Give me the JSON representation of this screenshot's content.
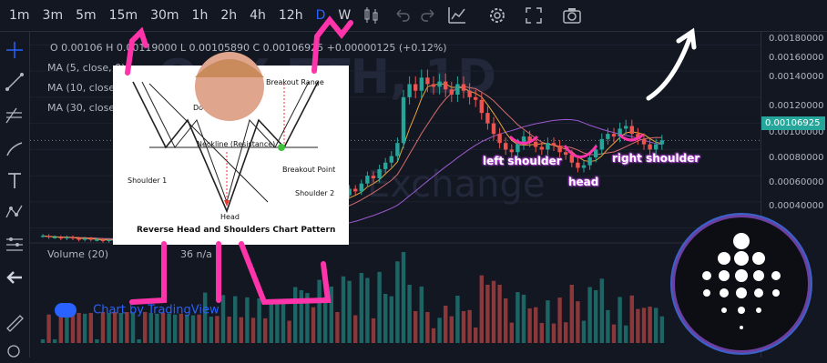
{
  "toolbar": {
    "timeframes": [
      "1m",
      "3m",
      "5m",
      "15m",
      "30m",
      "1h",
      "2h",
      "4h",
      "12h",
      "D",
      "W"
    ],
    "active_timeframe": "D"
  },
  "colors": {
    "up": "#26a69a",
    "down": "#ef5350",
    "ma5": "#e8a33d",
    "ma10": "#d46c6c",
    "ma30": "#9b59d0",
    "accent": "#2962ff",
    "annotation": "#ff33aa"
  },
  "legend": {
    "ohlc": "O 0.00106   H 0.00119000   L 0.00105890   C 0.00106925 +0.00000125 (+0.12%)",
    "ma5": "MA (5, close, 0)",
    "ma10": "MA (10, close, 0)",
    "ma30": "MA (30, close, 0)",
    "volume": "Volume (20)",
    "volume_value": "36   n/a"
  },
  "watermark": {
    "pair": "OAX-ETH, 1D",
    "exchange": "Exchange"
  },
  "credit": "Chart by TradingView",
  "last_price_label": "0.00106925",
  "inset": {
    "title": "Reverse Head and Shoulders Chart Pattern",
    "labels": {
      "breakout_range": "Breakout Range",
      "neckline": "Neckline (Resistance)",
      "breakout_point": "Breakout Point",
      "shoulder1": "Shoulder 1",
      "shoulder2": "Shoulder 2",
      "head": "Head",
      "downtrend": "Downtrend"
    }
  },
  "annotations": {
    "left_shoulder": "left shoulder",
    "head": "head",
    "right_shoulder": "right shoulder"
  },
  "chart_data": {
    "type": "candlestick",
    "price_ticks": [
      "0.00180000",
      "0.00160000",
      "0.00140000",
      "0.00120000",
      "0.00100000",
      "0.00080000",
      "0.00060000",
      "0.00040000"
    ],
    "y_range": [
      0.0003,
      0.0019
    ],
    "last_price": 0.00106925,
    "close": [
      0.00034,
      0.00033,
      0.00033,
      0.00032,
      0.00033,
      0.00032,
      0.00031,
      0.00032,
      0.00031,
      0.00031,
      0.0003,
      0.00031,
      0.0003,
      0.00031,
      0.0003,
      0.00031,
      0.00031,
      0.0003,
      0.00031,
      0.00032,
      0.00031,
      0.00032,
      0.00033,
      0.00032,
      0.00033,
      0.00034,
      0.00033,
      0.00035,
      0.00036,
      0.00035,
      0.00037,
      0.00036,
      0.00038,
      0.00037,
      0.00039,
      0.00038,
      0.0004,
      0.00039,
      0.00041,
      0.00043,
      0.00045,
      0.00044,
      0.00047,
      0.0005,
      0.00053,
      0.00051,
      0.00055,
      0.00058,
      0.00062,
      0.0006,
      0.00065,
      0.0007,
      0.00068,
      0.00074,
      0.0008,
      0.00078,
      0.00085,
      0.0009,
      0.00095,
      0.00105,
      0.0014,
      0.0015,
      0.00145,
      0.00155,
      0.0015,
      0.00148,
      0.00152,
      0.00146,
      0.00142,
      0.0015,
      0.00145,
      0.0014,
      0.00138,
      0.00128,
      0.0012,
      0.00112,
      0.00105,
      0.001,
      0.00098,
      0.00104,
      0.0011,
      0.00106,
      0.00102,
      0.001,
      0.00105,
      0.00103,
      0.00098,
      0.00096,
      0.0009,
      0.00086,
      0.00088,
      0.00094,
      0.001,
      0.00108,
      0.00112,
      0.0011,
      0.00116,
      0.00118,
      0.00112,
      0.00108,
      0.00104,
      0.001,
      0.00104,
      0.00107
    ]
  }
}
